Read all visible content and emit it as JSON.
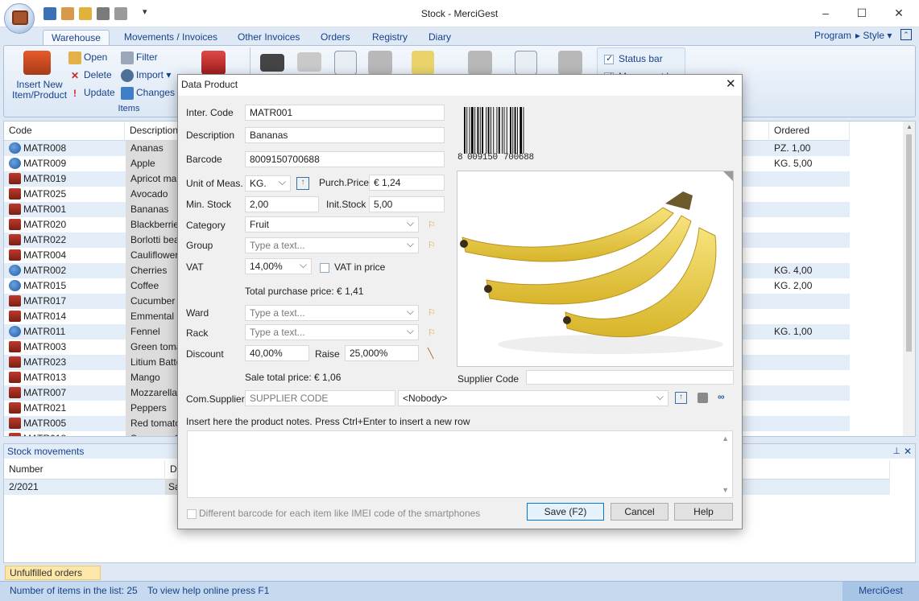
{
  "window": {
    "title": "Stock - MerciGest"
  },
  "tabs": [
    "Warehouse",
    "Movements / Invoices",
    "Other Invoices",
    "Orders",
    "Registry",
    "Diary"
  ],
  "right_menu": {
    "program": "Program",
    "style": "Style"
  },
  "ribbon": {
    "insert_label_1": "Insert New",
    "insert_label_2": "Item/Product",
    "open": "Open",
    "delete": "Delete",
    "update": "Update",
    "filter": "Filter",
    "import": "Import",
    "changes": "Changes",
    "group_items": "Items",
    "status_bar": "Status bar",
    "movement_bar": "Movement bar"
  },
  "grid": {
    "headers": {
      "code": "Code",
      "description": "Description",
      "ordered": "Ordered"
    },
    "rows": [
      {
        "code": "MATR008",
        "desc": "Ananas",
        "ordered": "PZ. 1,00",
        "icon": "globe"
      },
      {
        "code": "MATR009",
        "desc": "Apple",
        "ordered": "KG. 5,00",
        "icon": "globe"
      },
      {
        "code": "MATR019",
        "desc": "Apricot ma",
        "ordered": "",
        "icon": "box"
      },
      {
        "code": "MATR025",
        "desc": "Avocado",
        "ordered": "",
        "icon": "box"
      },
      {
        "code": "MATR001",
        "desc": "Bananas",
        "ordered": "",
        "icon": "box"
      },
      {
        "code": "MATR020",
        "desc": "Blackberries",
        "ordered": "",
        "icon": "box"
      },
      {
        "code": "MATR022",
        "desc": "Borlotti bea",
        "ordered": "",
        "icon": "box"
      },
      {
        "code": "MATR004",
        "desc": "Cauliflower",
        "ordered": "",
        "icon": "box"
      },
      {
        "code": "MATR002",
        "desc": "Cherries",
        "ordered": "KG. 4,00",
        "icon": "globe"
      },
      {
        "code": "MATR015",
        "desc": "Coffee",
        "ordered": "KG. 2,00",
        "icon": "globe"
      },
      {
        "code": "MATR017",
        "desc": "Cucumber",
        "ordered": "",
        "icon": "box"
      },
      {
        "code": "MATR014",
        "desc": "Emmental",
        "ordered": "",
        "icon": "box"
      },
      {
        "code": "MATR011",
        "desc": "Fennel",
        "ordered": "KG. 1,00",
        "icon": "globe"
      },
      {
        "code": "MATR003",
        "desc": "Green toma",
        "ordered": "",
        "icon": "box"
      },
      {
        "code": "MATR023",
        "desc": "Litium Batte",
        "ordered": "",
        "icon": "box"
      },
      {
        "code": "MATR013",
        "desc": "Mango",
        "ordered": "",
        "icon": "box"
      },
      {
        "code": "MATR007",
        "desc": "Mozzarella",
        "ordered": "",
        "icon": "box"
      },
      {
        "code": "MATR021",
        "desc": "Peppers",
        "ordered": "",
        "icon": "box"
      },
      {
        "code": "MATR005",
        "desc": "Red tomato",
        "ordered": "",
        "icon": "box"
      },
      {
        "code": "MATR018",
        "desc": "Samsung G",
        "ordered": "",
        "icon": "box"
      }
    ]
  },
  "movements": {
    "title": "Stock movements",
    "headers": {
      "number": "Number",
      "date": "Da"
    },
    "rows": [
      {
        "number": "2/2021",
        "date": "Sa"
      }
    ]
  },
  "unfulfilled": "Unfulfilled orders",
  "status": {
    "count": "Number of items in the list: 25",
    "help": "To view help online press F1",
    "brand": "MerciGest"
  },
  "dialog": {
    "title": "Data Product",
    "inter_code_label": "Inter. Code",
    "inter_code": "MATR001",
    "description_label": "Description",
    "description": "Bananas",
    "barcode_label": "Barcode",
    "barcode": "8009150700688",
    "barcode_caption": [
      "8",
      "009150",
      "700688"
    ],
    "unit_label": "Unit of Meas.",
    "unit": "KG.",
    "purch_price_label": "Purch.Price",
    "purch_price": "€ 1,24",
    "min_stock_label": "Min. Stock",
    "min_stock": "2,00",
    "init_stock_label": "Init.Stock",
    "init_stock": "5,00",
    "category_label": "Category",
    "category": "Fruit",
    "group_label": "Group",
    "group_placeholder": "Type a text...",
    "vat_label": "VAT",
    "vat": "14,00%",
    "vat_in_price_label": "VAT in price",
    "total_purchase": "Total purchase price: € 1,41",
    "ward_label": "Ward",
    "ward_placeholder": "Type a text...",
    "rack_label": "Rack",
    "rack_placeholder": "Type a text...",
    "discount_label": "Discount",
    "discount": "40,00%",
    "raise_label": "Raise",
    "raise": "25,000%",
    "sale_total": "Sale total price: € 1,06",
    "supplier_code_label": "Supplier Code",
    "com_supplier_label": "Com.Supplier",
    "supplier_code_placeholder": "SUPPLIER CODE",
    "supplier_select": "<Nobody>",
    "notes_label": "Insert here the product notes. Press Ctrl+Enter to insert a new row",
    "imei_label": "Different barcode for each item like IMEI code of the smartphones",
    "save": "Save (F2)",
    "cancel": "Cancel",
    "help": "Help"
  }
}
